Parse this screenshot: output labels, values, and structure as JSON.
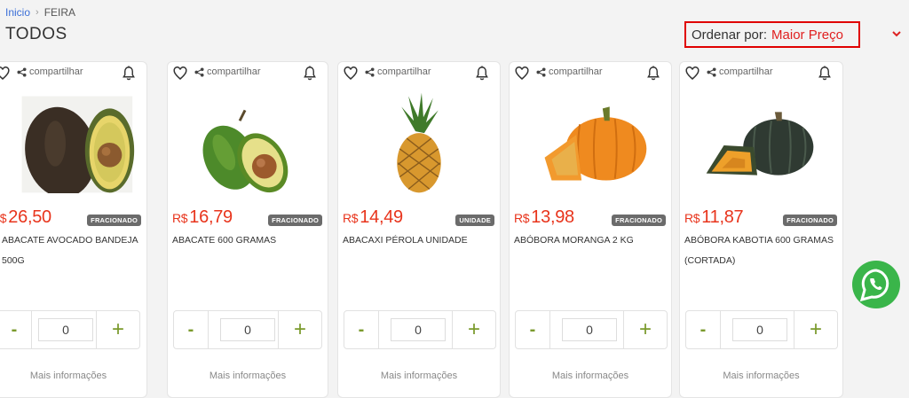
{
  "breadcrumb": {
    "home": "Inicio",
    "separator": "›",
    "current": "FEIRA"
  },
  "page_title": "TODOS",
  "sort": {
    "label": "Ordenar por:",
    "value": "Maior Preço"
  },
  "colors": {
    "accent": "#e8341c",
    "green": "#7a9a2c",
    "highlight": "#e00000",
    "whatsapp": "#3ab54a"
  },
  "products": [
    {
      "share": "compartilhar",
      "currency": "R$",
      "price": "26,50",
      "badge": "FRACIONADO",
      "name": "ABACATE AVOCADO BANDEJA 500G",
      "qty": "0",
      "minus": "-",
      "plus": "+",
      "more": "Mais informações",
      "image": "avocado-image"
    },
    {
      "share": "compartilhar",
      "currency": "R$",
      "price": "16,79",
      "badge": "FRACIONADO",
      "name": "ABACATE 600 GRAMAS",
      "qty": "0",
      "minus": "-",
      "plus": "+",
      "more": "Mais informações",
      "image": "avocado-image"
    },
    {
      "share": "compartilhar",
      "currency": "R$",
      "price": "14,49",
      "badge": "UNIDADE",
      "name": "ABACAXI PÉROLA UNIDADE",
      "qty": "0",
      "minus": "-",
      "plus": "+",
      "more": "Mais informações",
      "image": "pineapple-image"
    },
    {
      "share": "compartilhar",
      "currency": "R$",
      "price": "13,98",
      "badge": "FRACIONADO",
      "name": "ABÓBORA MORANGA 2 KG",
      "qty": "0",
      "minus": "-",
      "plus": "+",
      "more": "Mais informações",
      "image": "pumpkin-image"
    },
    {
      "share": "compartilhar",
      "currency": "R$",
      "price": "11,87",
      "badge": "FRACIONADO",
      "name": "ABÓBORA KABOTIA 600 GRAMAS (CORTADA)",
      "qty": "0",
      "minus": "-",
      "plus": "+",
      "more": "Mais informações",
      "image": "kabocha-image"
    }
  ]
}
